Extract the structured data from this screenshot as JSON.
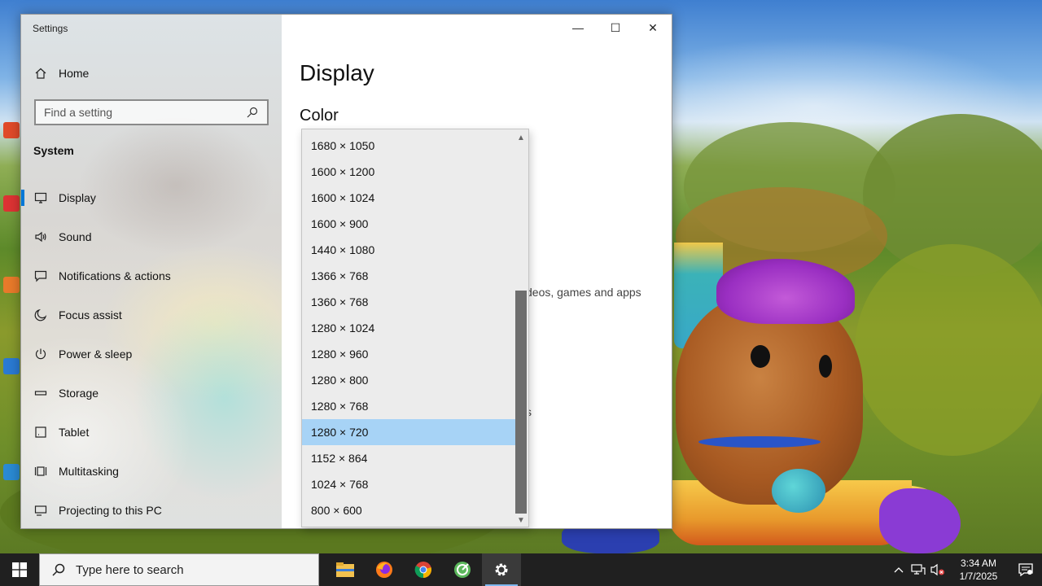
{
  "window": {
    "title": "Settings",
    "minimize_glyph": "—",
    "maximize_glyph": "☐",
    "close_glyph": "✕"
  },
  "sidebar": {
    "home_label": "Home",
    "search_placeholder": "Find a setting",
    "section_label": "System",
    "items": [
      {
        "label": "Display",
        "icon": "monitor-icon",
        "active": true
      },
      {
        "label": "Sound",
        "icon": "speaker-icon"
      },
      {
        "label": "Notifications & actions",
        "icon": "message-icon"
      },
      {
        "label": "Focus assist",
        "icon": "moon-icon"
      },
      {
        "label": "Power & sleep",
        "icon": "power-icon"
      },
      {
        "label": "Storage",
        "icon": "storage-icon"
      },
      {
        "label": "Tablet",
        "icon": "tablet-icon"
      },
      {
        "label": "Multitasking",
        "icon": "multitasking-icon"
      },
      {
        "label": "Projecting to this PC",
        "icon": "projector-icon"
      }
    ]
  },
  "content": {
    "title": "Display",
    "subtitle": "Color",
    "partial_text": "deos, games and apps",
    "partial_char": "s"
  },
  "resolution_dropdown": {
    "options": [
      "1680 × 1050",
      "1600 × 1200",
      "1600 × 1024",
      "1600 × 900",
      "1440 × 1080",
      "1366 × 768",
      "1360 × 768",
      "1280 × 1024",
      "1280 × 960",
      "1280 × 800",
      "1280 × 768",
      "1280 × 720",
      "1152 × 864",
      "1024 × 768",
      "800 × 600"
    ],
    "selected": "1280 × 720"
  },
  "taskbar": {
    "search_placeholder": "Type here to search",
    "apps": [
      "file-explorer-icon",
      "firefox-icon",
      "chrome-icon",
      "clean-master-icon",
      "settings-gear-icon"
    ],
    "active_app": "settings-gear-icon",
    "time": "3:34 AM",
    "date": "1/7/2025"
  },
  "colors": {
    "accent": "#0078d7",
    "selected_option": "#a7d3f6",
    "taskbar": "#202020"
  }
}
